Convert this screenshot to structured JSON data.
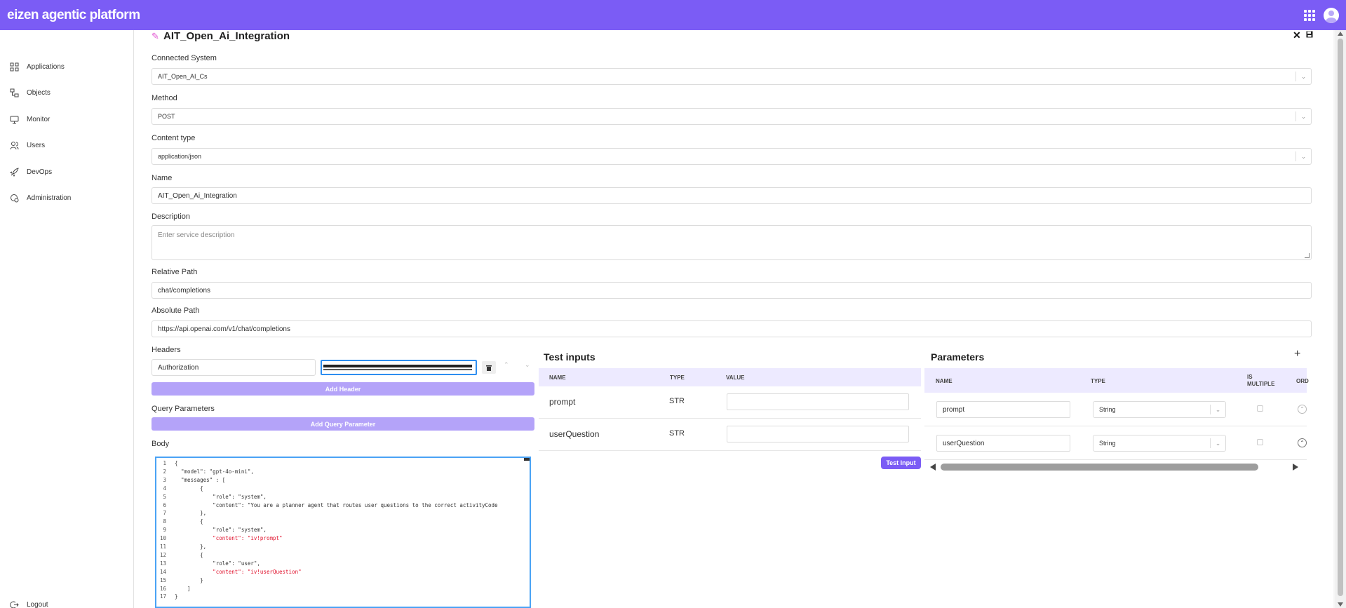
{
  "app": {
    "brand": "eizen agentic platform"
  },
  "sidebar": {
    "items": [
      {
        "label": "Applications",
        "icon": "grid-icon"
      },
      {
        "label": "Objects",
        "icon": "objects-icon"
      },
      {
        "label": "Monitor",
        "icon": "monitor-icon"
      },
      {
        "label": "Users",
        "icon": "users-icon"
      },
      {
        "label": "DevOps",
        "icon": "rocket-icon"
      },
      {
        "label": "Administration",
        "icon": "admin-icon"
      }
    ],
    "logout": "Logout"
  },
  "form": {
    "title": "AIT_Open_Ai_Integration",
    "connected_system_label": "Connected System",
    "connected_system_value": "AIT_Open_AI_Cs",
    "method_label": "Method",
    "method_value": "POST",
    "content_type_label": "Content type",
    "content_type_value": "application/json",
    "name_label": "Name",
    "name_value": "AIT_Open_Ai_Integration",
    "description_label": "Description",
    "description_placeholder": "Enter service description",
    "relative_path_label": "Relative Path",
    "relative_path_value": "chat/completions",
    "absolute_path_label": "Absolute Path",
    "absolute_path_value": "https://api.openai.com/v1/chat/completions",
    "headers_label": "Headers",
    "header_key": "Authorization",
    "add_header": "Add Header",
    "query_params_label": "Query Parameters",
    "add_query_param": "Add Query Parameter",
    "body_label": "Body"
  },
  "body_code": [
    {
      "n": "1",
      "text": "{"
    },
    {
      "n": "2",
      "text": "  \"model\": \"gpt-4o-mini\","
    },
    {
      "n": "3",
      "text": "  \"messages\" : ["
    },
    {
      "n": "4",
      "text": "        {"
    },
    {
      "n": "5",
      "text": "            \"role\": \"system\","
    },
    {
      "n": "6",
      "text": "            \"content\": \"You are a planner agent that routes user questions to the correct activityCode"
    },
    {
      "n": "7",
      "text": "        },"
    },
    {
      "n": "8",
      "text": "        {"
    },
    {
      "n": "9",
      "text": "            \"role\": \"system\","
    },
    {
      "n": "10",
      "text": "            \"content\": \"iv!prompt\""
    },
    {
      "n": "11",
      "text": "        },"
    },
    {
      "n": "12",
      "text": "        {"
    },
    {
      "n": "13",
      "text": "            \"role\": \"user\","
    },
    {
      "n": "14",
      "text": "            \"content\": \"iv!userQuestion\""
    },
    {
      "n": "15",
      "text": "        }"
    },
    {
      "n": "16",
      "text": "    ]"
    },
    {
      "n": "17",
      "text": "}"
    }
  ],
  "test_inputs": {
    "title": "Test inputs",
    "columns": [
      "NAME",
      "TYPE",
      "VALUE"
    ],
    "rows": [
      {
        "name": "prompt",
        "type": "STR",
        "value": ""
      },
      {
        "name": "userQuestion",
        "type": "STR",
        "value": ""
      }
    ],
    "button": "Test Input"
  },
  "parameters": {
    "title": "Parameters",
    "add": "+",
    "columns": [
      "NAME",
      "TYPE",
      "IS MULTIPLE",
      "ORD"
    ],
    "rows": [
      {
        "name": "prompt",
        "type": "String"
      },
      {
        "name": "userQuestion",
        "type": "String"
      }
    ]
  },
  "icons": {
    "close": "close-icon",
    "save": "save-icon",
    "edit": "pencil-icon",
    "delete": "trash-icon"
  },
  "colors": {
    "accent": "#7b5cf5",
    "accent_light": "#b4a3f9",
    "table_header": "#edeaff"
  }
}
